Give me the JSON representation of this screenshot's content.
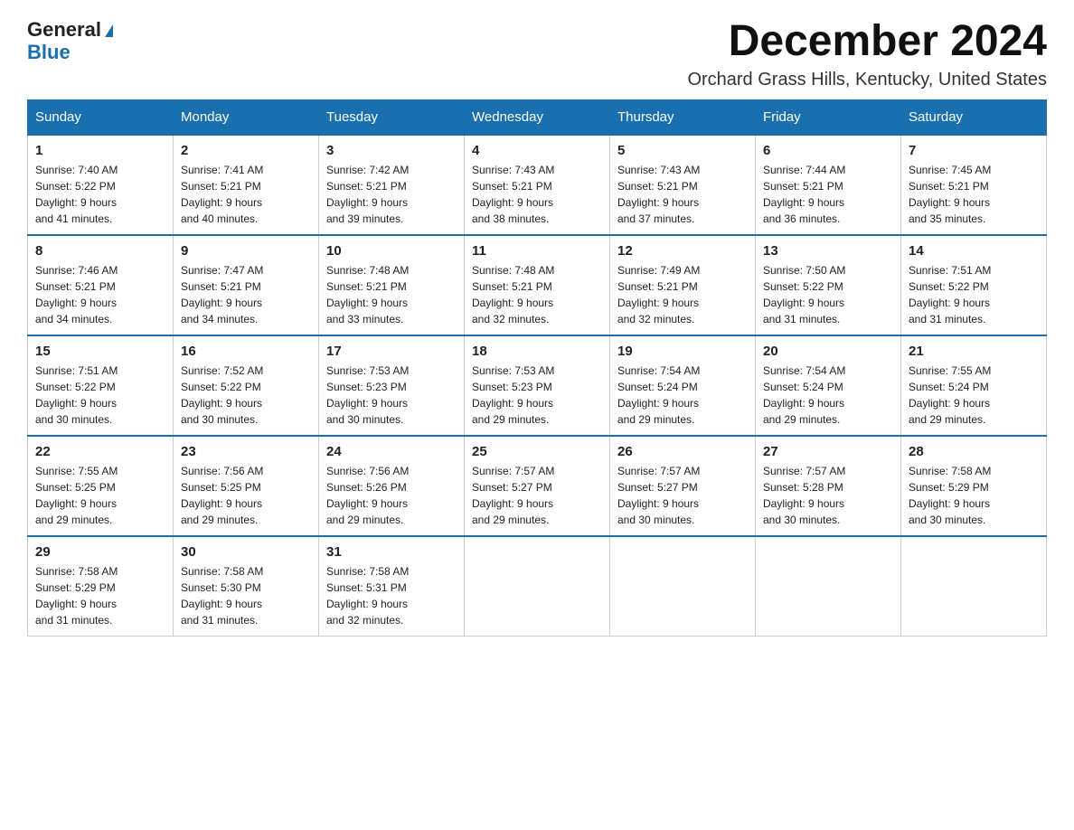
{
  "logo": {
    "general": "General",
    "blue": "Blue",
    "triangle": "▶"
  },
  "header": {
    "month": "December 2024",
    "location": "Orchard Grass Hills, Kentucky, United States"
  },
  "weekdays": [
    "Sunday",
    "Monday",
    "Tuesday",
    "Wednesday",
    "Thursday",
    "Friday",
    "Saturday"
  ],
  "weeks": [
    [
      {
        "day": "1",
        "sunrise": "7:40 AM",
        "sunset": "5:22 PM",
        "daylight": "9 hours and 41 minutes."
      },
      {
        "day": "2",
        "sunrise": "7:41 AM",
        "sunset": "5:21 PM",
        "daylight": "9 hours and 40 minutes."
      },
      {
        "day": "3",
        "sunrise": "7:42 AM",
        "sunset": "5:21 PM",
        "daylight": "9 hours and 39 minutes."
      },
      {
        "day": "4",
        "sunrise": "7:43 AM",
        "sunset": "5:21 PM",
        "daylight": "9 hours and 38 minutes."
      },
      {
        "day": "5",
        "sunrise": "7:43 AM",
        "sunset": "5:21 PM",
        "daylight": "9 hours and 37 minutes."
      },
      {
        "day": "6",
        "sunrise": "7:44 AM",
        "sunset": "5:21 PM",
        "daylight": "9 hours and 36 minutes."
      },
      {
        "day": "7",
        "sunrise": "7:45 AM",
        "sunset": "5:21 PM",
        "daylight": "9 hours and 35 minutes."
      }
    ],
    [
      {
        "day": "8",
        "sunrise": "7:46 AM",
        "sunset": "5:21 PM",
        "daylight": "9 hours and 34 minutes."
      },
      {
        "day": "9",
        "sunrise": "7:47 AM",
        "sunset": "5:21 PM",
        "daylight": "9 hours and 34 minutes."
      },
      {
        "day": "10",
        "sunrise": "7:48 AM",
        "sunset": "5:21 PM",
        "daylight": "9 hours and 33 minutes."
      },
      {
        "day": "11",
        "sunrise": "7:48 AM",
        "sunset": "5:21 PM",
        "daylight": "9 hours and 32 minutes."
      },
      {
        "day": "12",
        "sunrise": "7:49 AM",
        "sunset": "5:21 PM",
        "daylight": "9 hours and 32 minutes."
      },
      {
        "day": "13",
        "sunrise": "7:50 AM",
        "sunset": "5:22 PM",
        "daylight": "9 hours and 31 minutes."
      },
      {
        "day": "14",
        "sunrise": "7:51 AM",
        "sunset": "5:22 PM",
        "daylight": "9 hours and 31 minutes."
      }
    ],
    [
      {
        "day": "15",
        "sunrise": "7:51 AM",
        "sunset": "5:22 PM",
        "daylight": "9 hours and 30 minutes."
      },
      {
        "day": "16",
        "sunrise": "7:52 AM",
        "sunset": "5:22 PM",
        "daylight": "9 hours and 30 minutes."
      },
      {
        "day": "17",
        "sunrise": "7:53 AM",
        "sunset": "5:23 PM",
        "daylight": "9 hours and 30 minutes."
      },
      {
        "day": "18",
        "sunrise": "7:53 AM",
        "sunset": "5:23 PM",
        "daylight": "9 hours and 29 minutes."
      },
      {
        "day": "19",
        "sunrise": "7:54 AM",
        "sunset": "5:24 PM",
        "daylight": "9 hours and 29 minutes."
      },
      {
        "day": "20",
        "sunrise": "7:54 AM",
        "sunset": "5:24 PM",
        "daylight": "9 hours and 29 minutes."
      },
      {
        "day": "21",
        "sunrise": "7:55 AM",
        "sunset": "5:24 PM",
        "daylight": "9 hours and 29 minutes."
      }
    ],
    [
      {
        "day": "22",
        "sunrise": "7:55 AM",
        "sunset": "5:25 PM",
        "daylight": "9 hours and 29 minutes."
      },
      {
        "day": "23",
        "sunrise": "7:56 AM",
        "sunset": "5:25 PM",
        "daylight": "9 hours and 29 minutes."
      },
      {
        "day": "24",
        "sunrise": "7:56 AM",
        "sunset": "5:26 PM",
        "daylight": "9 hours and 29 minutes."
      },
      {
        "day": "25",
        "sunrise": "7:57 AM",
        "sunset": "5:27 PM",
        "daylight": "9 hours and 29 minutes."
      },
      {
        "day": "26",
        "sunrise": "7:57 AM",
        "sunset": "5:27 PM",
        "daylight": "9 hours and 30 minutes."
      },
      {
        "day": "27",
        "sunrise": "7:57 AM",
        "sunset": "5:28 PM",
        "daylight": "9 hours and 30 minutes."
      },
      {
        "day": "28",
        "sunrise": "7:58 AM",
        "sunset": "5:29 PM",
        "daylight": "9 hours and 30 minutes."
      }
    ],
    [
      {
        "day": "29",
        "sunrise": "7:58 AM",
        "sunset": "5:29 PM",
        "daylight": "9 hours and 31 minutes."
      },
      {
        "day": "30",
        "sunrise": "7:58 AM",
        "sunset": "5:30 PM",
        "daylight": "9 hours and 31 minutes."
      },
      {
        "day": "31",
        "sunrise": "7:58 AM",
        "sunset": "5:31 PM",
        "daylight": "9 hours and 32 minutes."
      },
      null,
      null,
      null,
      null
    ]
  ]
}
